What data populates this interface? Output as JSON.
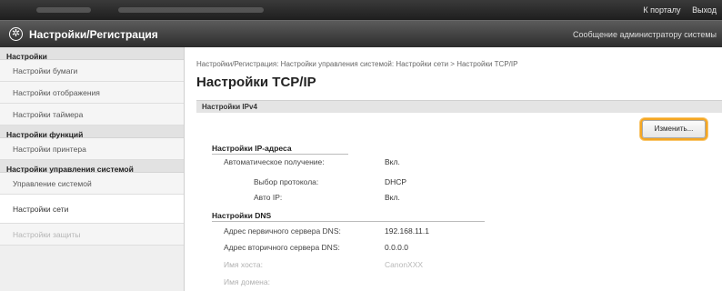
{
  "topbar": {
    "links": [
      "К порталу",
      "Выход"
    ]
  },
  "header": {
    "app_title": "Настройки/Регистрация",
    "admin_message": "Сообщение администратору системы"
  },
  "sidebar": {
    "groups": [
      {
        "heading": "Настройки",
        "items": [
          "Настройки бумаги",
          "Настройки отображения",
          "Настройки таймера"
        ]
      },
      {
        "heading": "Настройки функций",
        "items": [
          "Настройки принтера"
        ]
      },
      {
        "heading": "Настройки управления системой",
        "items": [
          "Управление системой",
          "Настройки сети",
          "Настройки защиты"
        ]
      }
    ]
  },
  "main": {
    "breadcrumb": "Настройки/Регистрация: Настройки управления системой: Настройки сети > Настройки TCP/IP",
    "page_title": "Настройки TCP/IP",
    "section_title": "Настройки IPv4",
    "edit_button": "Изменить...",
    "ip_address": {
      "title": "Настройки IP-адреса",
      "auto_label": "Автоматическое получение:",
      "auto_value": "Вкл.",
      "protocol_label": "Выбор протокола:",
      "protocol_value": "DHCP",
      "autoip_label": "Авто IP:",
      "autoip_value": "Вкл."
    },
    "dns": {
      "title": "Настройки DNS",
      "primary_label": "Адрес первичного сервера DNS:",
      "primary_value": "192.168.11.1",
      "secondary_label": "Адрес вторичного сервера DNS:",
      "secondary_value": "0.0.0.0",
      "host_label": "Имя хоста:",
      "host_value": "CanonXXX",
      "domain_label": "Имя домена:"
    }
  }
}
